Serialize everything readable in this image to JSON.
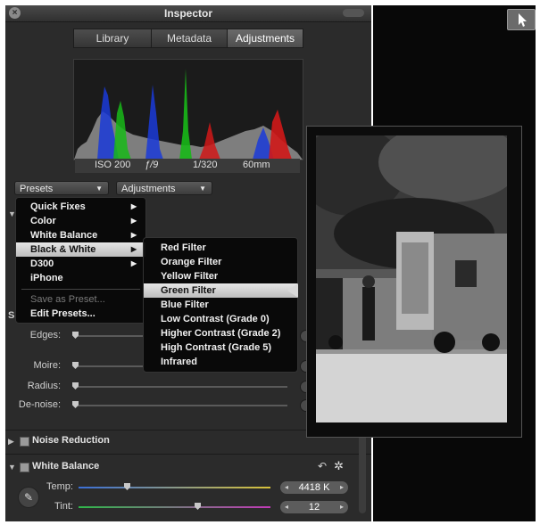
{
  "window": {
    "title": "Inspector"
  },
  "tabs": [
    {
      "label": "Library"
    },
    {
      "label": "Metadata"
    },
    {
      "label": "Adjustments"
    }
  ],
  "exif": {
    "iso": "ISO 200",
    "aperture": "ƒ/9",
    "shutter": "1/320",
    "focal": "60mm"
  },
  "dropdowns": {
    "presets": "Presets",
    "adjustments": "Adjustments"
  },
  "presets_menu": {
    "items": [
      {
        "label": "Quick Fixes",
        "submenu": true
      },
      {
        "label": "Color",
        "submenu": true
      },
      {
        "label": "White Balance",
        "submenu": true
      },
      {
        "label": "Black & White",
        "submenu": true,
        "highlighted": true
      },
      {
        "label": "D300",
        "submenu": true
      },
      {
        "label": "iPhone",
        "submenu": false
      }
    ],
    "save_label": "Save as Preset...",
    "edit_label": "Edit Presets..."
  },
  "bw_submenu": {
    "items": [
      {
        "label": "Red Filter"
      },
      {
        "label": "Orange Filter"
      },
      {
        "label": "Yellow Filter"
      },
      {
        "label": "Green Filter",
        "highlighted": true
      },
      {
        "label": "Blue Filter"
      },
      {
        "label": "Low Contrast (Grade 0)"
      },
      {
        "label": "Higher Contrast (Grade 2)"
      },
      {
        "label": "High Contrast (Grade 5)"
      },
      {
        "label": "Infrared"
      }
    ]
  },
  "sliders": {
    "edges": {
      "label": "Edges:",
      "value": 0
    },
    "moire": {
      "label": "Moire:",
      "value": 0
    },
    "radius": {
      "label": "Radius:",
      "value": 0
    },
    "denoise": {
      "label": "De-noise:",
      "value": 0
    }
  },
  "sections": {
    "noise_reduction": {
      "label": "Noise Reduction"
    },
    "white_balance": {
      "label": "White Balance"
    }
  },
  "white_balance": {
    "temp_label": "Temp:",
    "temp_value": "4418 K",
    "tint_label": "Tint:",
    "tint_value": "12"
  },
  "colors": {
    "panel": "#2b2b2b",
    "histogram_red": "#d01818",
    "histogram_green": "#18b818",
    "histogram_blue": "#1a3ad8"
  }
}
